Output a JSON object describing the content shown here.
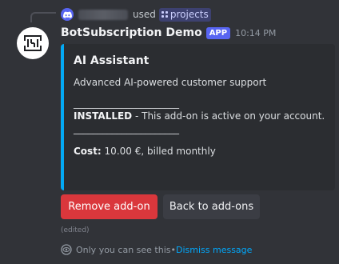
{
  "reply": {
    "used_text": "used",
    "command_name": "projects"
  },
  "message": {
    "username": "BotSubscription Demo",
    "badge": "APP",
    "timestamp": "10:14 PM",
    "accent_color": "#03a9f4"
  },
  "embed": {
    "title": "AI Assistant",
    "description": "Advanced AI-powered customer support",
    "divider": "______________________",
    "status_label": "INSTALLED",
    "status_text": " - This add-on is active on your account.",
    "cost_label": "Cost:",
    "cost_value": " 10.00 €, billed monthly"
  },
  "buttons": {
    "remove_label": "Remove add-on",
    "back_label": "Back to add-ons"
  },
  "footer": {
    "edited": "(edited)",
    "only_you_text": "Only you can see this",
    "separator": " • ",
    "dismiss_text": "Dismiss message"
  },
  "colors": {
    "background": "#313338",
    "embed_background": "#2b2d31",
    "danger": "#da373c",
    "blurple": "#5865f2",
    "link": "#00a8fc"
  }
}
